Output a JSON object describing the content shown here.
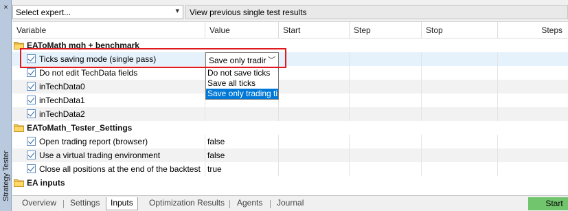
{
  "panel": {
    "close_glyph": "×",
    "title": "Strategy Tester"
  },
  "toolbar": {
    "expert_select_value": "Select expert...",
    "previous_results_label": "View previous single test results"
  },
  "columns": [
    "Variable",
    "Value",
    "Start",
    "Step",
    "Stop",
    "Steps"
  ],
  "rows": [
    {
      "kind": "group",
      "label": "EAToMath mqh + benchmark"
    },
    {
      "kind": "param",
      "label": "Ticks saving mode (single pass)",
      "value": "",
      "checked": true,
      "selected": true
    },
    {
      "kind": "param",
      "label": "Do not edit TechData fields",
      "value": "",
      "checked": true
    },
    {
      "kind": "param",
      "label": "inTechData0",
      "value": "",
      "checked": true
    },
    {
      "kind": "param",
      "label": "inTechData1",
      "value": "",
      "checked": true
    },
    {
      "kind": "param",
      "label": "inTechData2",
      "value": "",
      "checked": true
    },
    {
      "kind": "group",
      "label": "EAToMath_Tester_Settings"
    },
    {
      "kind": "param",
      "label": "Open trading report (browser)",
      "value": "false",
      "checked": true
    },
    {
      "kind": "param",
      "label": "Use a virtual trading environment",
      "value": "false",
      "checked": true
    },
    {
      "kind": "param",
      "label": "Close all positions at the end of the backtest",
      "value": "true",
      "checked": true
    },
    {
      "kind": "group",
      "label": "EA inputs"
    }
  ],
  "combo": {
    "value": "Save only tradir",
    "options": [
      "Do not save ticks",
      "Save all ticks",
      "Save only trading ti"
    ],
    "highlighted_index": 2
  },
  "tabs": [
    "Overview",
    "Settings",
    "Inputs",
    "Optimization Results",
    "Agents",
    "Journal"
  ],
  "active_tab": "Inputs",
  "start_label": "Start",
  "colors": {
    "accent": "#0078d7",
    "highlight_box": "#e0191f",
    "start_button": "#71c56c",
    "selected_row": "#e5f1fb"
  },
  "icons": {
    "folder": "folder-icon",
    "checkbox": "checkbox-icon",
    "chevron": "chevron-down-icon"
  }
}
